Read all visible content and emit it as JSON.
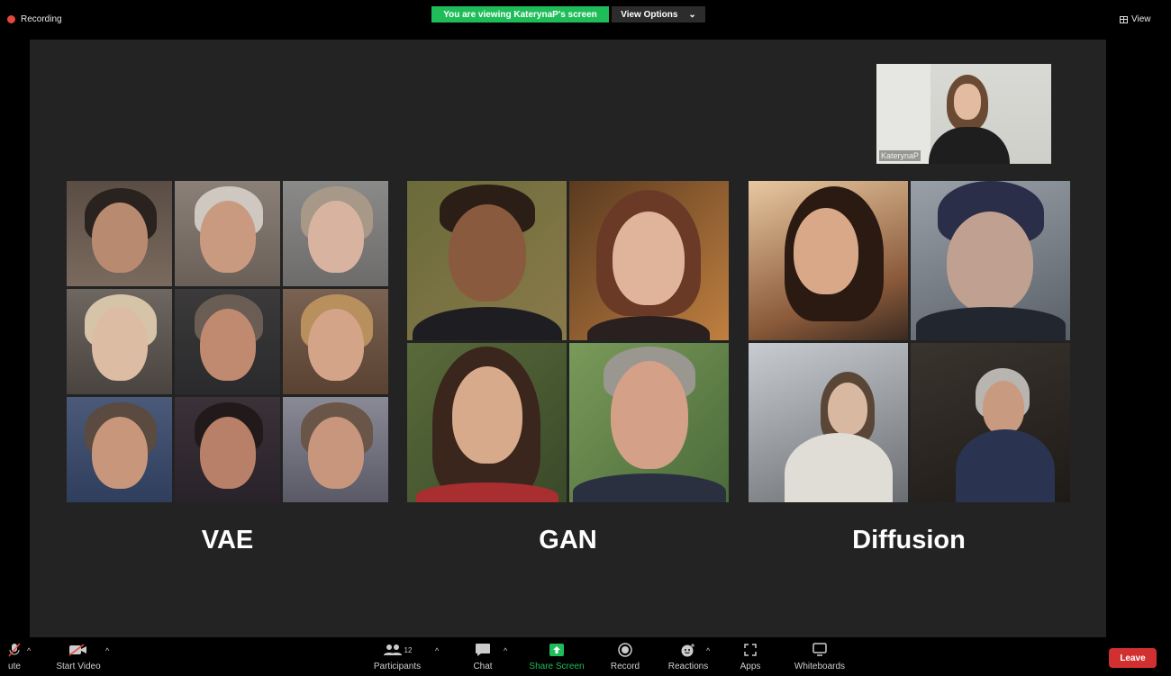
{
  "topbar": {
    "recording_label": "Recording",
    "viewing_banner": "You are viewing KaterynaP's screen",
    "view_options_label": "View Options",
    "view_label": "View"
  },
  "participant_thumbnail": {
    "name": "KaterynaP"
  },
  "slide": {
    "labels": [
      "VAE",
      "GAN",
      "Diffusion"
    ]
  },
  "toolbar": {
    "mute_label": "ute",
    "start_video_label": "Start Video",
    "participants_label": "Participants",
    "participants_count": "12",
    "chat_label": "Chat",
    "share_screen_label": "Share Screen",
    "record_label": "Record",
    "reactions_label": "Reactions",
    "apps_label": "Apps",
    "whiteboards_label": "Whiteboards",
    "leave_label": "Leave"
  },
  "colors": {
    "banner_green": "#1fbd59",
    "share_green": "#1fbd59",
    "leave_red": "#d0302f",
    "recording_red": "#e5483a",
    "stage_bg": "#232323"
  }
}
